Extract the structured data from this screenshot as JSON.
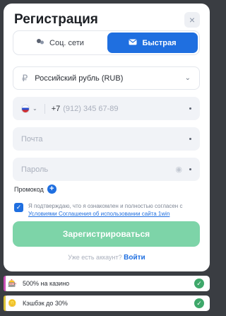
{
  "title": "Регистрация",
  "close_icon": "×",
  "tabs": {
    "social": "Соц. сети",
    "fast": "Быстрая"
  },
  "currency": {
    "value": "Российский рубль (RUB)",
    "symbol": "₽"
  },
  "phone": {
    "code": "+7",
    "placeholder": "(912) 345 67-89"
  },
  "email_placeholder": "Почта",
  "password_placeholder": "Пароль",
  "promo_label": "Промокод",
  "agreement": {
    "text": "Я подтверждаю, что я ознакомлен и полностью согласен с",
    "link": "Условиями Соглашения об использовании сайта 1win"
  },
  "register_button": "Зарегистрироваться",
  "login": {
    "question": "Уже есть аккаунт?",
    "link": "Войти"
  },
  "bonuses": [
    {
      "label": "500% на казино",
      "color": "#c94fb5"
    },
    {
      "label": "Кэшбэк до 30%",
      "color": "#d8c23a"
    }
  ],
  "colors": {
    "accent": "#1f6fe0",
    "register_bg": "#7dd4a8",
    "tick": "#3ea86a"
  }
}
